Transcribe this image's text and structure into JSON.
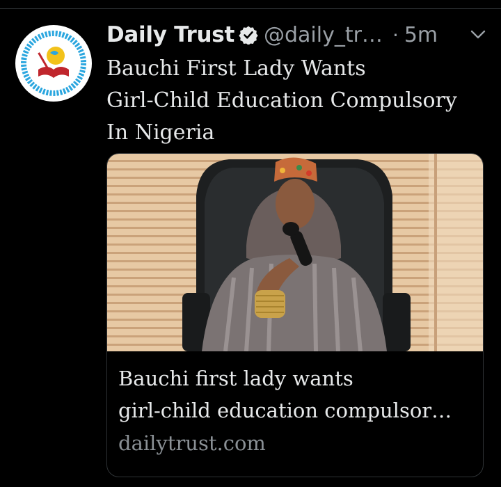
{
  "tweet": {
    "author_name": "Daily Trust",
    "handle": "@daily_tr…",
    "separator": "·",
    "time": "5m",
    "text_lines": [
      "Bauchi First Lady Wants",
      "Girl-Child Education Compulsory",
      "In Nigeria"
    ]
  },
  "card": {
    "title_lines": [
      "Bauchi first lady wants",
      "girl-child education compulsor…"
    ],
    "domain": "dailytrust.com"
  },
  "icons": {
    "verified": "verified-badge-icon",
    "menu": "chevron-down-icon",
    "avatar": "daily-trust-logo"
  },
  "colors": {
    "background": "#000000",
    "text": "#e7e9ea",
    "secondary": "#9aa0a6",
    "border": "#2f3336",
    "logo_blue": "#2aa6df"
  }
}
